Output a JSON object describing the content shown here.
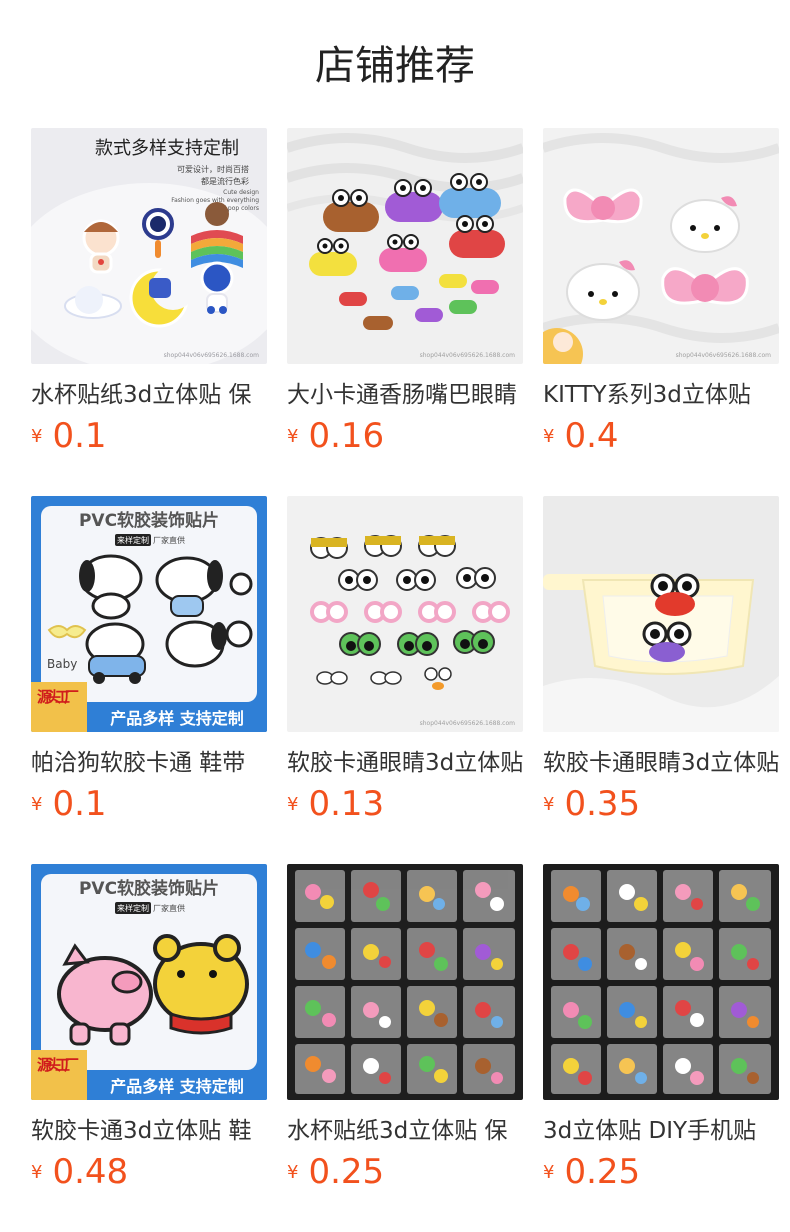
{
  "page": {
    "title": "店铺推荐"
  },
  "currency_symbol": "¥",
  "colors": {
    "price": "#f2511d",
    "title": "#222222",
    "text": "#333333"
  },
  "products": [
    {
      "name": "水杯贴纸3d立体贴 保",
      "price": "0.1",
      "image": {
        "icon": "space-sticker-image",
        "headline": "款式多样支持定制",
        "sub1": "可爱设计，时尚百搭",
        "sub2": "都是流行色彩",
        "sub3": "Cute design",
        "sub4": "Fashion goes with everything",
        "sub5": "Cool pop colors",
        "watermark": "shop044v06v695626.1688.com"
      }
    },
    {
      "name": "大小卡通香肠嘴巴眼睛",
      "price": "0.16",
      "image": {
        "icon": "sausage-mouth-image",
        "watermark": "shop044v06v695626.1688.com"
      }
    },
    {
      "name": "KITTY系列3d立体贴",
      "price": "0.4",
      "image": {
        "icon": "kitty-bow-image",
        "watermark": "shop044v06v695626.1688.com"
      }
    },
    {
      "name": "帕洽狗软胶卡通 鞋带",
      "price": "0.1",
      "image": {
        "icon": "pochacco-sticker-image",
        "headline": "PVC软胶装饰贴片",
        "tag1": "来样定制",
        "tag2": "厂家直供",
        "badge": "源头工厂",
        "banner": "产品多样 支持定制",
        "baby": "Baby"
      }
    },
    {
      "name": "软胶卡通眼睛3d立体贴",
      "price": "0.13",
      "image": {
        "icon": "cartoon-eyes-image",
        "watermark": "shop044v06v695626.1688.com"
      }
    },
    {
      "name": "软胶卡通眼睛3d立体贴",
      "price": "0.35",
      "image": {
        "icon": "cup-eyes-image"
      }
    },
    {
      "name": "软胶卡通3d立体贴 鞋",
      "price": "0.48",
      "image": {
        "icon": "pig-bear-sticker-image",
        "headline": "PVC软胶装饰贴片",
        "tag1": "来样定制",
        "tag2": "厂家直供",
        "badge": "源头工厂",
        "banner": "产品多样 支持定制"
      }
    },
    {
      "name": "水杯贴纸3d立体贴 保",
      "price": "0.25",
      "image": {
        "icon": "bagged-stickers-image"
      }
    },
    {
      "name": "3d立体贴 DIY手机贴",
      "price": "0.25",
      "image": {
        "icon": "bagged-stickers-image"
      }
    }
  ]
}
